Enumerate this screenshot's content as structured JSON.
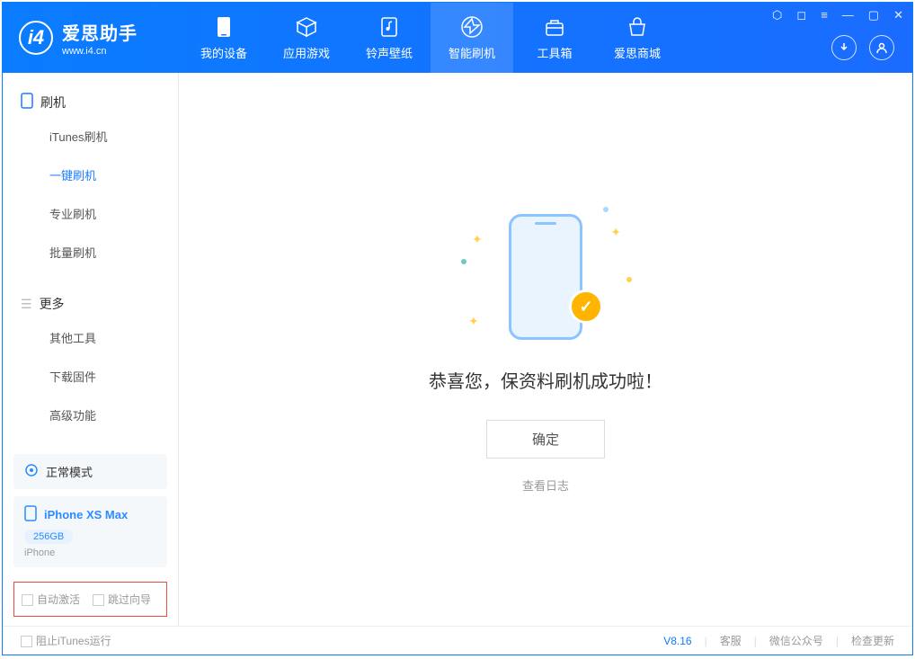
{
  "header": {
    "app_name": "爱思助手",
    "app_url": "www.i4.cn",
    "tabs": [
      {
        "label": "我的设备"
      },
      {
        "label": "应用游戏"
      },
      {
        "label": "铃声壁纸"
      },
      {
        "label": "智能刷机"
      },
      {
        "label": "工具箱"
      },
      {
        "label": "爱思商城"
      }
    ]
  },
  "sidebar": {
    "s1": {
      "title": "刷机",
      "items": [
        "iTunes刷机",
        "一键刷机",
        "专业刷机",
        "批量刷机"
      ]
    },
    "s2": {
      "title": "更多",
      "items": [
        "其他工具",
        "下载固件",
        "高级功能"
      ]
    },
    "mode": {
      "label": "正常模式"
    },
    "device": {
      "name": "iPhone XS Max",
      "storage": "256GB",
      "type": "iPhone"
    },
    "opts": {
      "auto_activate": "自动激活",
      "skip_guide": "跳过向导"
    }
  },
  "main": {
    "success": "恭喜您，保资料刷机成功啦！",
    "ok": "确定",
    "view_log": "查看日志"
  },
  "footer": {
    "block_itunes": "阻止iTunes运行",
    "version": "V8.16",
    "links": [
      "客服",
      "微信公众号",
      "检查更新"
    ]
  }
}
